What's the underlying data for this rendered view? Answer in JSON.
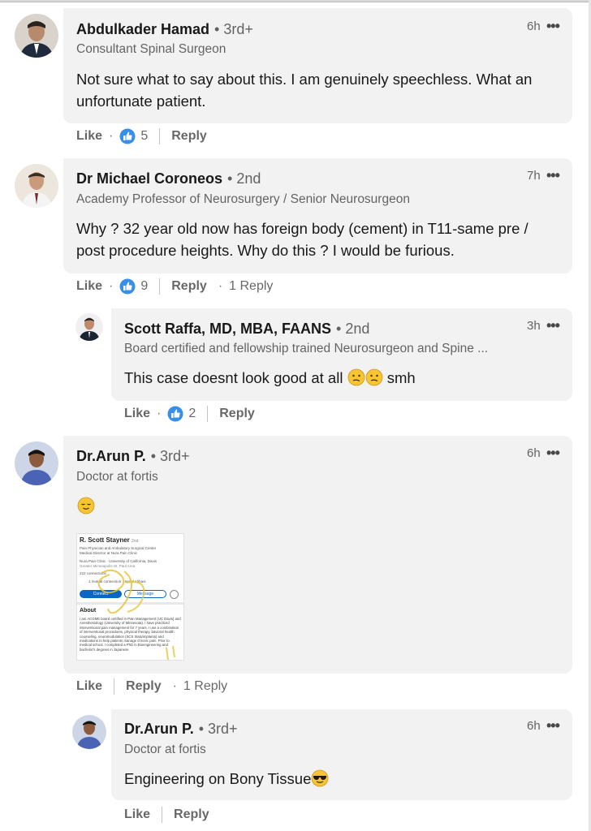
{
  "comments": [
    {
      "name": "Abdulkader Hamad",
      "degree": "• 3rd+",
      "headline": "Consultant Spinal Surgeon",
      "time": "6h",
      "text": "Not sure what to say about this. I am genuinely speechless. What an unfortunate patient.",
      "like_label": "Like",
      "reaction_count": "5",
      "reply_label": "Reply"
    },
    {
      "name": "Dr Michael Coroneos",
      "degree": "• 2nd",
      "headline": "Academy Professor of Neurosurgery / Senior Neurosurgeon",
      "time": "7h",
      "text": "Why ? 32 year old now has foreign body (cement) in T11-same pre / post procedure heights. Why do this ? I would be furious.",
      "like_label": "Like",
      "reaction_count": "9",
      "reply_label": "Reply",
      "replies_count": "1 Reply"
    },
    {
      "name": "Scott Raffa, MD, MBA, FAANS",
      "degree": "• 2nd",
      "headline": "Board certified and fellowship trained Neurosurgeon and Spine ...",
      "time": "3h",
      "text": "This case doesnt look good at all",
      "text_suffix": "smh",
      "like_label": "Like",
      "reaction_count": "2",
      "reply_label": "Reply"
    },
    {
      "name": "Dr.Arun P.",
      "degree": "• 3rd+",
      "headline": "Doctor at fortis",
      "time": "6h",
      "like_label": "Like",
      "reply_label": "Reply",
      "replies_count": "1 Reply"
    },
    {
      "name": "Dr.Arun P.",
      "degree": "• 3rd+",
      "headline": "Doctor at fortis",
      "time": "6h",
      "text": "Engineering on Bony Tissue",
      "like_label": "Like",
      "reply_label": "Reply"
    }
  ],
  "attachment": {
    "name": "R. Scott Stayner",
    "degree": "2nd",
    "lines": [
      "Pain Physician and Ambulatory Surgical Center",
      "Medical Director at Nura Pain Clinic",
      "Nura Pain Clinic · University of California, Davis",
      "Greater Minneapolis-St. Paul Area",
      "222 connections",
      "1 mutual connection: Hamid Abbasi"
    ],
    "connect": "Connect",
    "message": "Message",
    "about_title": "About",
    "about_text": "I am ACGME board certified in Pain Management (UC Davis) and Anesthesiology (University of Minnesota). I have practiced interventional pain management for 7 years. I use a combination of interventional procedures, physical therapy, bavioral health counseling, neuromodulation (SCS trials/implants) and medications to help patients manage chronic pain. Prior to medical school, I completed a PhD in Bioengineering and bachelor's degrees in Japanese"
  },
  "more_icon": "ellipsis-icon",
  "colors": {
    "bubble": "#f2f2f2",
    "like_blue": "#378fe9",
    "text": "#191919",
    "muted": "#666666"
  }
}
